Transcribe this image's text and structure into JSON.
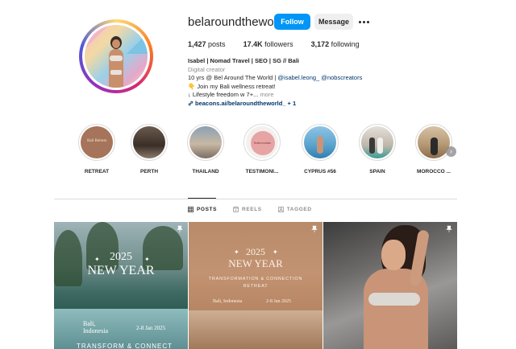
{
  "profile": {
    "username": "belaroundtheworld_",
    "follow_label": "Follow",
    "message_label": "Message",
    "stats": {
      "posts_count": "1,427",
      "posts_label": "posts",
      "followers_count": "17.4K",
      "followers_label": "followers",
      "following_count": "3,172",
      "following_label": "following"
    },
    "bio": {
      "name": "Isabel | Nomad Travel | SEO | SG // Bali",
      "category": "Digital creator",
      "line1_prefix": "10 yrs @ Bel Around The World | ",
      "mention1": "@isabel.leong_",
      "mention2": "@nobscreators",
      "line2": "👇 Join my Bali wellness retreat!",
      "line3": "↓ Lifestyle freedom w 7+...",
      "more": "more",
      "link": "beacons.ai/belaroundtheworld_",
      "link_extra": "+ 1"
    }
  },
  "highlights": [
    {
      "label": "RETREAT",
      "cover_text": "Bali Retreat"
    },
    {
      "label": "PERTH"
    },
    {
      "label": "THAILAND"
    },
    {
      "label": "TESTIMONI...",
      "cover_text": "Testimonials"
    },
    {
      "label": "CYPRUS #56"
    },
    {
      "label": "SPAIN"
    },
    {
      "label": "MOROCCO ..."
    }
  ],
  "tabs": [
    {
      "label": "POSTS",
      "icon": "grid-icon",
      "active": true
    },
    {
      "label": "REELS",
      "icon": "reels-icon",
      "active": false
    },
    {
      "label": "TAGGED",
      "icon": "tagged-icon",
      "active": false
    }
  ],
  "posts": [
    {
      "title_year": "2025",
      "title_main": "NEW YEAR",
      "location": "Bali,\nIndonesia",
      "dates": "2-8 Jan 2025",
      "footer": "TRANSFORM & CONNECT"
    },
    {
      "title_year": "2025",
      "title_main": "NEW YEAR",
      "subtitle": "TRANSFORMATION & CONNECTION\nRETREAT",
      "location": "Bali, Indonesia",
      "dates": "2-8 Jan 2025"
    },
    {}
  ],
  "colors": {
    "accent_blue": "#0095f6",
    "link_blue": "#00376b",
    "muted": "#8e8e8e",
    "border": "#dbdbdb"
  }
}
